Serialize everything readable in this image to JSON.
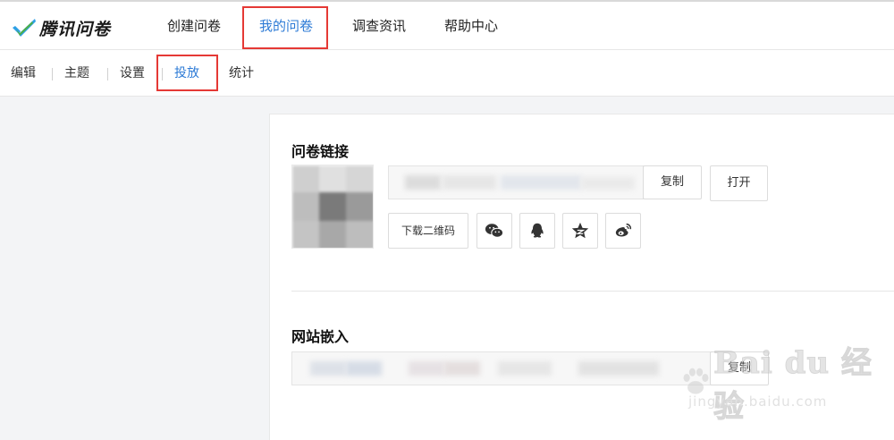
{
  "logo": {
    "text": "腾讯问卷",
    "icon": "check-logo-icon",
    "colors": [
      "#2ea0e6",
      "#4cae4c"
    ]
  },
  "nav": {
    "items": [
      {
        "label": "创建问卷"
      },
      {
        "label": "我的问卷",
        "active": true
      },
      {
        "label": "调查资讯"
      },
      {
        "label": "帮助中心"
      }
    ]
  },
  "subnav": {
    "items": [
      {
        "label": "编辑"
      },
      {
        "label": "主题"
      },
      {
        "label": "设置"
      },
      {
        "label": "投放",
        "active": true
      },
      {
        "label": "统计"
      }
    ]
  },
  "link_section": {
    "title": "问卷链接",
    "copy_label": "复制",
    "open_label": "打开",
    "download_qr_label": "下载二维码",
    "share_icons": [
      "wechat-icon",
      "qq-icon",
      "qzone-icon",
      "weibo-icon"
    ]
  },
  "embed_section": {
    "title": "网站嵌入",
    "copy_label": "复制"
  },
  "watermark": {
    "brand": "Bai du 经验",
    "url": "jingyan.baidu.com"
  },
  "colors": {
    "accent": "#2e7bd6",
    "highlight": "#e53935"
  }
}
